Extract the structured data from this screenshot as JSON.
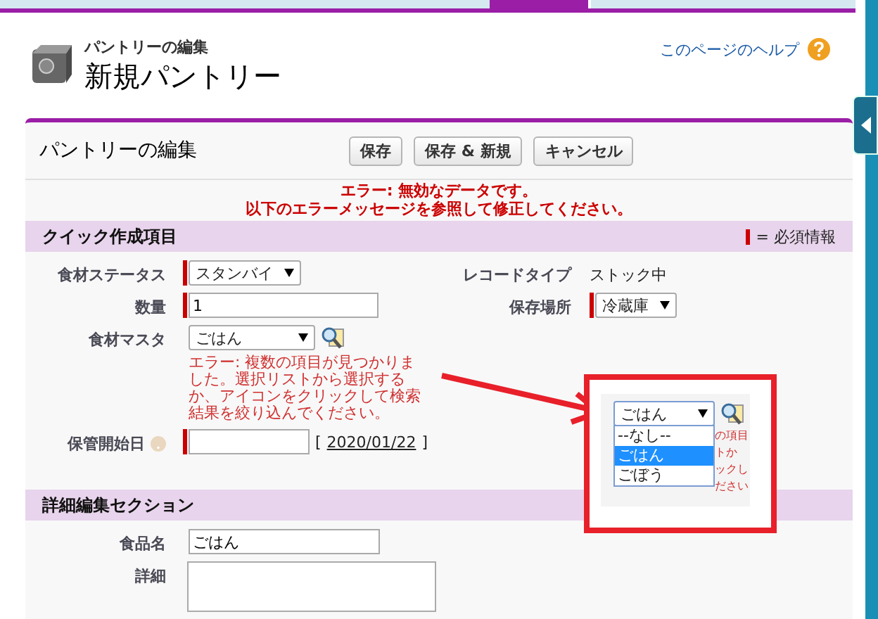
{
  "header": {
    "subtitle": "パントリーの編集",
    "title": "新規パントリー",
    "help_link": "このページのヘルプ"
  },
  "panel": {
    "title": "パントリーの編集",
    "buttons": [
      "保存",
      "保存 & 新規",
      "キャンセル"
    ],
    "error_lines": [
      "エラー: 無効なデータです。",
      "以下のエラーメッセージを参照して修正してください。"
    ]
  },
  "sections": [
    {
      "title": "クイック作成項目",
      "legend": "= 必須情報",
      "rows": [
        {
          "left": {
            "label": "食材ステータス",
            "kind": "select",
            "value": "スタンバイ",
            "required": true
          },
          "right": {
            "label": "レコードタイプ",
            "kind": "static",
            "value": "ストック中",
            "required": false
          }
        },
        {
          "left": {
            "label": "数量",
            "kind": "text",
            "value": "1",
            "required": true
          },
          "right": {
            "label": "保存場所",
            "kind": "select",
            "value": "冷蔵庫",
            "required": true
          }
        },
        {
          "left": {
            "label": "食材マスタ",
            "kind": "lookup",
            "value": "ごはん",
            "required": false,
            "error": "エラー: 複数の項目が見つかりました。選択リストから選択するか、アイコンをクリックして検索結果を絞り込んでください。"
          }
        },
        {
          "left": {
            "label": "保管開始日",
            "kind": "date",
            "required": true,
            "help": true,
            "date_open": "[",
            "date_link": "2020/01/22",
            "date_close": "]"
          }
        }
      ]
    },
    {
      "title": "詳細編集セクション",
      "rows": [
        {
          "left": {
            "label": "食品名",
            "kind": "text",
            "value": "ごはん",
            "required": false
          }
        },
        {
          "left": {
            "label": "詳細",
            "kind": "textarea",
            "required": false
          }
        }
      ]
    }
  ],
  "annotation": {
    "value": "ごはん",
    "options": [
      {
        "label": "--なし--",
        "selected": false
      },
      {
        "label": "ごはん",
        "selected": true
      },
      {
        "label": "ごぼう",
        "selected": false
      }
    ],
    "error_fragments": [
      "の項目",
      "トか",
      "ックし",
      "ださい"
    ]
  }
}
